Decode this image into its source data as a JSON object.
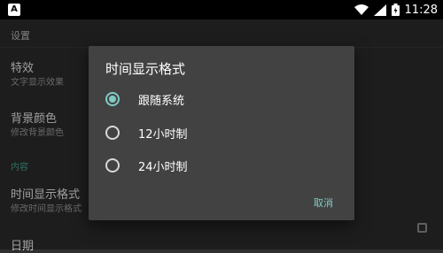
{
  "status_bar": {
    "left_icon": "A",
    "time": "11:28",
    "icons": [
      "wifi-icon",
      "signal-icon",
      "battery-icon"
    ]
  },
  "settings": {
    "header": "设置",
    "items": [
      {
        "title": "特效",
        "subtitle": "文字显示效果"
      },
      {
        "title": "背景颜色",
        "subtitle": "修改背景颜色"
      }
    ],
    "section": "内容",
    "content_items": [
      {
        "title": "时间显示格式",
        "subtitle": "修改时间显示格式"
      },
      {
        "title": "日期"
      }
    ]
  },
  "dialog": {
    "title": "时间显示格式",
    "options": [
      {
        "label": "跟随系统",
        "selected": true
      },
      {
        "label": "12小时制",
        "selected": false
      },
      {
        "label": "24小时制",
        "selected": false
      }
    ],
    "cancel_label": "取消"
  },
  "colors": {
    "accent": "#80cbc4",
    "section": "#4bb5a4",
    "dialog_bg": "#424242",
    "page_bg": "#2f2f2f"
  }
}
